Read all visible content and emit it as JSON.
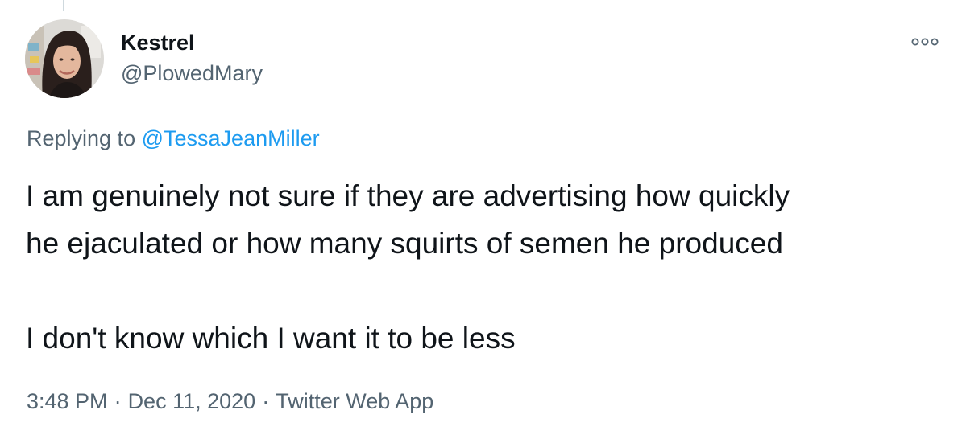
{
  "tweet": {
    "author": {
      "display_name": "Kestrel",
      "handle": "@PlowedMary",
      "avatar_icon": "profile-photo"
    },
    "more_icon": "more-options-icon",
    "replying": {
      "prefix": "Replying to",
      "mention": "@TessaJeanMiller"
    },
    "text": {
      "line1": "I am genuinely not sure if they are advertising how quickly",
      "line2": "he ejaculated or how many squirts of semen he produced",
      "line3": "I don't know which I want it to be less"
    },
    "time": "3:48 PM",
    "separator": "·",
    "date": "Dec 11, 2020",
    "source": "Twitter Web App"
  },
  "colors": {
    "text_primary": "#0f1419",
    "text_secondary": "#536471",
    "link": "#1d9bf0",
    "background": "#ffffff"
  }
}
